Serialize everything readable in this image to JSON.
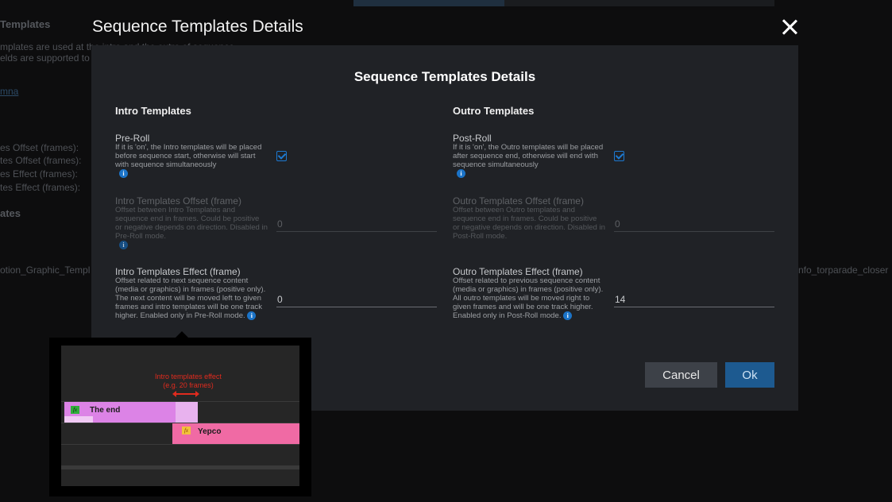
{
  "background": {
    "section1_title": "Templates",
    "desc_line1": "mplates are used at the intro and the outro of sequence.",
    "desc_line2": "elds are supported to",
    "link": "mna",
    "rows": [
      "es Offset (frames):",
      "tes Offset (frames):",
      "es Effect (frames):",
      "tes Effect (frames):"
    ],
    "section2_title": "ates",
    "left_value": "otion_Graphic_Templ",
    "right_value": "nfo_torparade_closer"
  },
  "overlay": {
    "title": "Sequence Templates Details"
  },
  "dialog": {
    "title": "Sequence Templates Details",
    "intro": {
      "title": "Intro Templates",
      "preroll_label": "Pre-Roll",
      "preroll_desc": "If it is 'on', the Intro templates will be placed before sequence start, otherwise will start with sequence simultaneously",
      "preroll_checked": true,
      "offset_label": "Intro Templates Offset (frame)",
      "offset_desc": "Offset between Intro Templates and sequence end in frames. Could be positive or negative depends on direction. Disabled in Pre-Roll mode.",
      "offset_value": "0",
      "effect_label": "Intro Templates Effect (frame)",
      "effect_desc": "Offset related to next sequence content (media or graphics) in frames (positive only). The next content will be moved left to given frames and intro templates will be one track higher. Enabled only in Pre-Roll mode.",
      "effect_value": "0"
    },
    "outro": {
      "title": "Outro Templates",
      "postroll_label": "Post-Roll",
      "postroll_desc": "If it is 'on', the Outro templates will be placed after sequence end, otherwise will end with sequence simultaneously",
      "postroll_checked": true,
      "offset_label": "Outro Templates Offset (frame)",
      "offset_desc": "Offset between Outro templates and sequence end in frames. Could be positive or negative depends on direction. Disabled in Post-Roll mode.",
      "offset_value": "0",
      "effect_label": "Outro Templates Effect (frame)",
      "effect_desc": "Offset related to previous sequence content (media or graphics) in frames (positive only). All outro templates will be moved right to given frames and will be one track higher. Enabled only in Post-Roll mode.",
      "effect_value": "14"
    },
    "cancel_label": "Cancel",
    "ok_label": "Ok"
  },
  "tooltip": {
    "note_line1": "Intro templates effect",
    "note_line2": "(e.g. 20 frames)",
    "clip_a": "The end",
    "clip_b": "Yepco",
    "fx_glyph": "fx"
  },
  "icons": {
    "info": "i"
  },
  "colors": {
    "accent": "#1d79d0",
    "ok_button": "#1d5a90",
    "cancel_button": "#3d4148",
    "dialog_bg": "#202226",
    "clip_a": "#dc83e6",
    "clip_b": "#f06aa4",
    "effect_note": "#e02b1e"
  }
}
